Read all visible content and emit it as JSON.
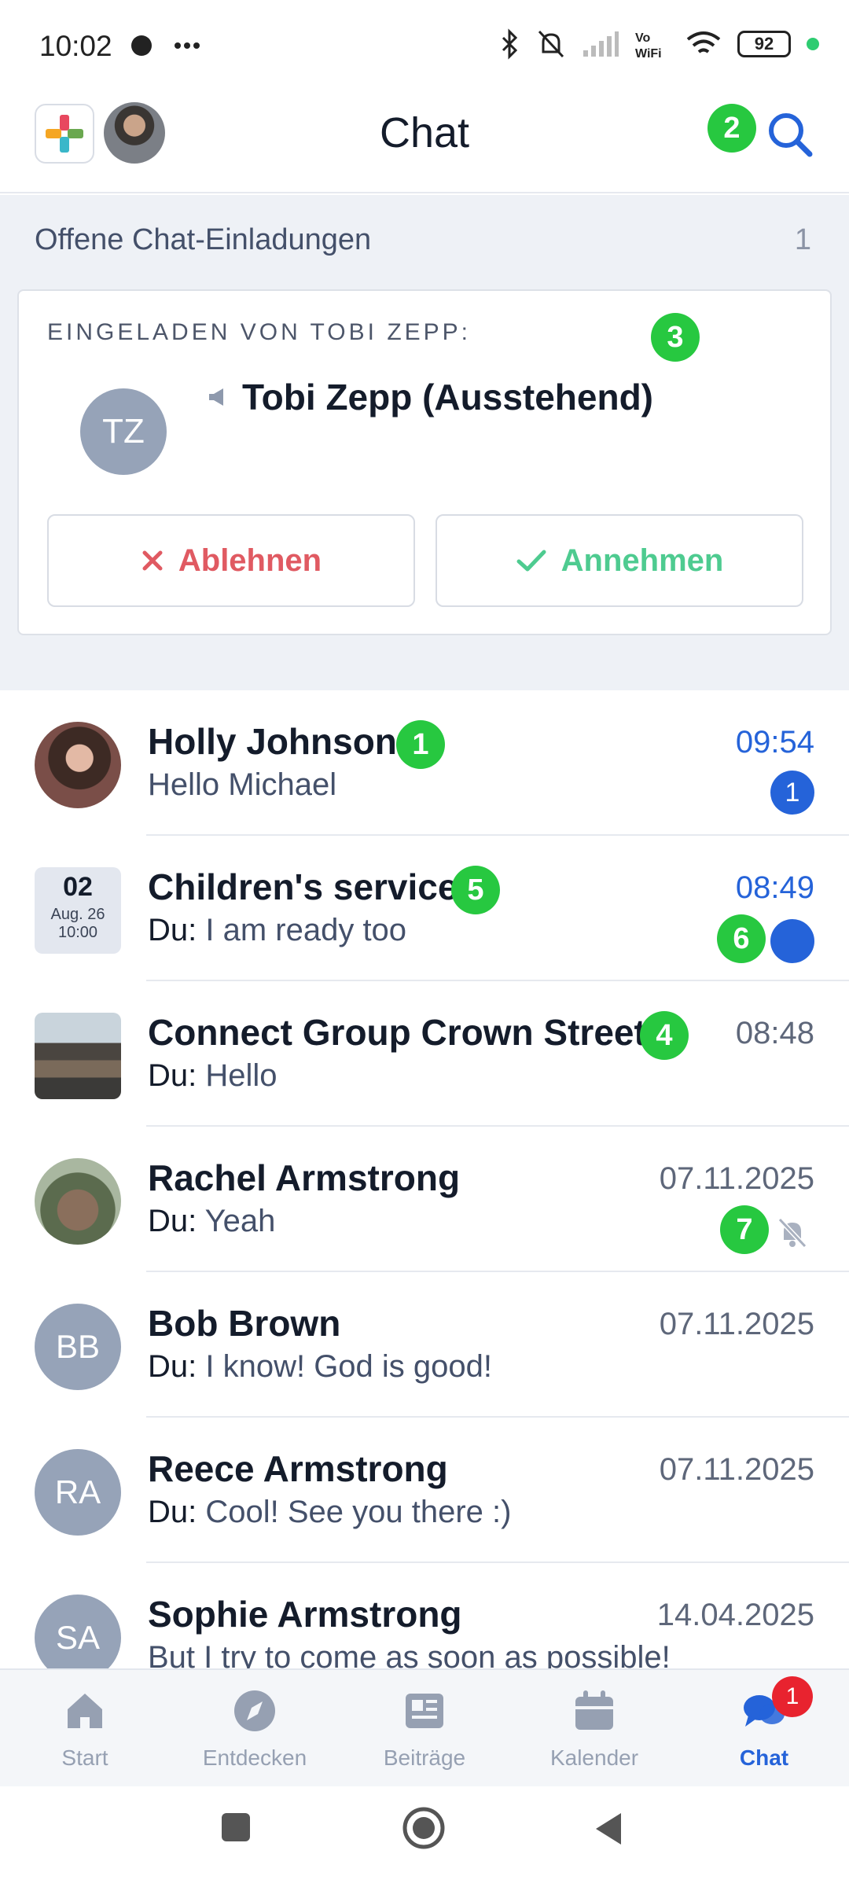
{
  "status_bar": {
    "time": "10:02",
    "battery": "92"
  },
  "header": {
    "title": "Chat"
  },
  "invitations": {
    "heading": "Offene Chat-Einladungen",
    "count": "1",
    "invited_by": "EINGELADEN VON TOBI ZEPP:",
    "avatar_initials": "TZ",
    "name": "Tobi Zepp (Ausstehend)",
    "decline_label": "Ablehnen",
    "accept_label": "Annehmen"
  },
  "annotations": [
    "1",
    "2",
    "3",
    "4",
    "5",
    "6",
    "7"
  ],
  "chats": [
    {
      "name": "Holly Johnson",
      "prefix": "",
      "preview": "Hello Michael",
      "time": "09:54",
      "unread_count": "1"
    },
    {
      "name": "Children's service",
      "prefix": "Du:",
      "preview": " I am ready too",
      "time": "08:49",
      "date_tile": {
        "day": "02",
        "month": "Aug. 26",
        "time": "10:00"
      }
    },
    {
      "name": "Connect Group Crown Street",
      "prefix": "Du:",
      "preview": " Hello",
      "time": "08:48"
    },
    {
      "name": "Rachel Armstrong",
      "prefix": "Du:",
      "preview": " Yeah",
      "time": "07.11.2025"
    },
    {
      "name": "Bob Brown",
      "prefix": "Du:",
      "preview": " I know! God is good!",
      "time": "07.11.2025",
      "initials": "BB"
    },
    {
      "name": "Reece Armstrong",
      "prefix": "Du:",
      "preview": " Cool! See you there :)",
      "time": "07.11.2025",
      "initials": "RA"
    },
    {
      "name": "Sophie Armstrong",
      "prefix": "",
      "preview": "But I try to come as soon as possible!",
      "time": "14.04.2025",
      "initials": "SA"
    }
  ],
  "bottom_nav": {
    "items": [
      {
        "label": "Start",
        "icon": "home-icon"
      },
      {
        "label": "Entdecken",
        "icon": "compass-icon"
      },
      {
        "label": "Beiträge",
        "icon": "newspaper-icon"
      },
      {
        "label": "Kalender",
        "icon": "calendar-icon"
      },
      {
        "label": "Chat",
        "icon": "chat-icon",
        "badge": "1"
      }
    ]
  },
  "colors": {
    "accent": "#2563d9",
    "annotation": "#27c840",
    "decline": "#e05a62",
    "accept": "#4ecb90"
  }
}
